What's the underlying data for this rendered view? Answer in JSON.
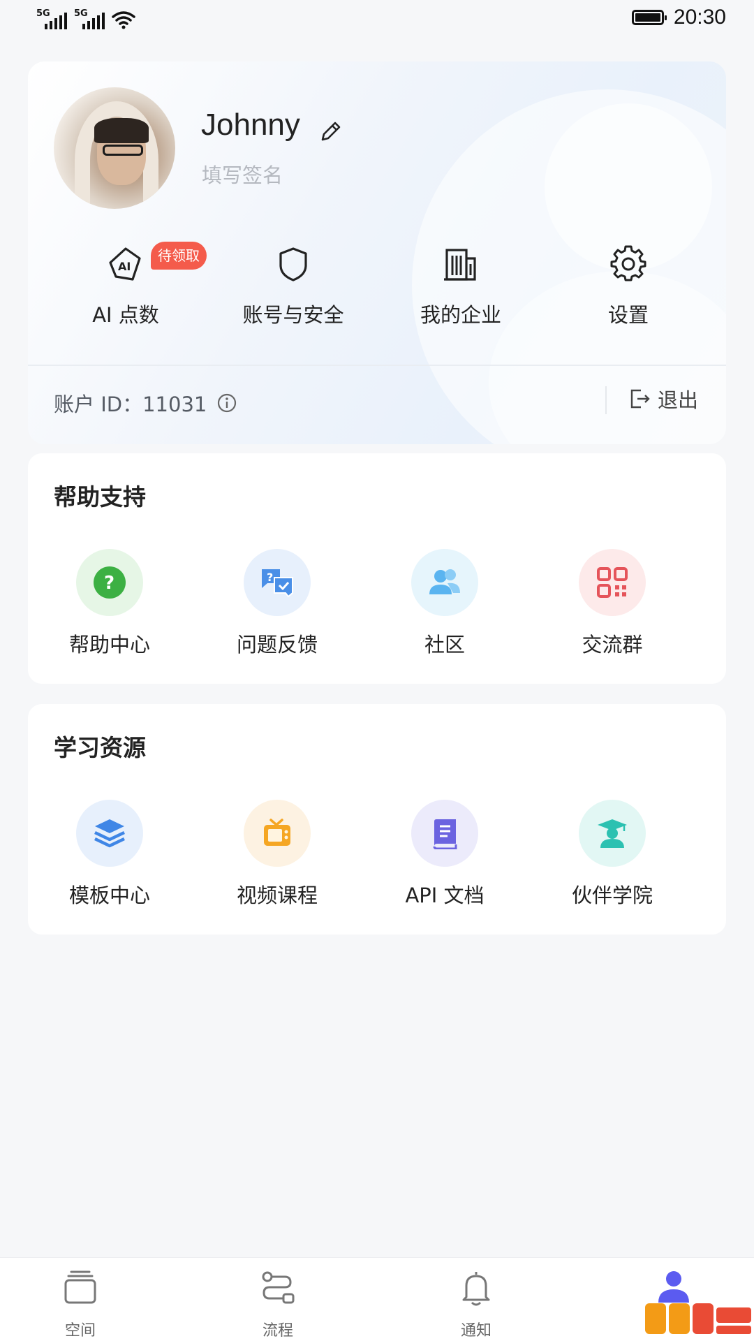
{
  "status_bar": {
    "signal_1": "5G",
    "signal_2": "5G",
    "time": "20:30"
  },
  "profile": {
    "username": "Johnny",
    "signature_placeholder": "填写签名",
    "account_id_label": "账户 ID：11031",
    "logout_label": "退出"
  },
  "quick_actions": [
    {
      "label": "AI 点数",
      "icon": "ai-points-icon",
      "badge": "待领取"
    },
    {
      "label": "账号与安全",
      "icon": "shield-icon"
    },
    {
      "label": "我的企业",
      "icon": "building-icon"
    },
    {
      "label": "设置",
      "icon": "gear-icon"
    }
  ],
  "help_support": {
    "title": "帮助支持",
    "items": [
      {
        "label": "帮助中心",
        "icon": "question-icon",
        "color": "#3cb043"
      },
      {
        "label": "问题反馈",
        "icon": "feedback-chat-icon",
        "color": "#4a8fe7"
      },
      {
        "label": "社区",
        "icon": "community-icon",
        "color": "#5ab4f0"
      },
      {
        "label": "交流群",
        "icon": "qr-code-icon",
        "color": "#e5545a"
      }
    ]
  },
  "learning": {
    "title": "学习资源",
    "items": [
      {
        "label": "模板中心",
        "icon": "layers-icon",
        "color": "#3f86e6"
      },
      {
        "label": "视频课程",
        "icon": "tv-icon",
        "color": "#f5a623"
      },
      {
        "label": "API 文档",
        "icon": "book-icon",
        "color": "#6b63e0"
      },
      {
        "label": "伙伴学院",
        "icon": "graduate-icon",
        "color": "#2cc1b1"
      }
    ]
  },
  "bottom_nav": [
    {
      "label": "空间",
      "icon": "space-icon"
    },
    {
      "label": "流程",
      "icon": "flow-icon"
    },
    {
      "label": "通知",
      "icon": "bell-icon"
    },
    {
      "label": "",
      "icon": "profile-icon",
      "active": true
    }
  ],
  "accent_color": "#5b5bf0"
}
